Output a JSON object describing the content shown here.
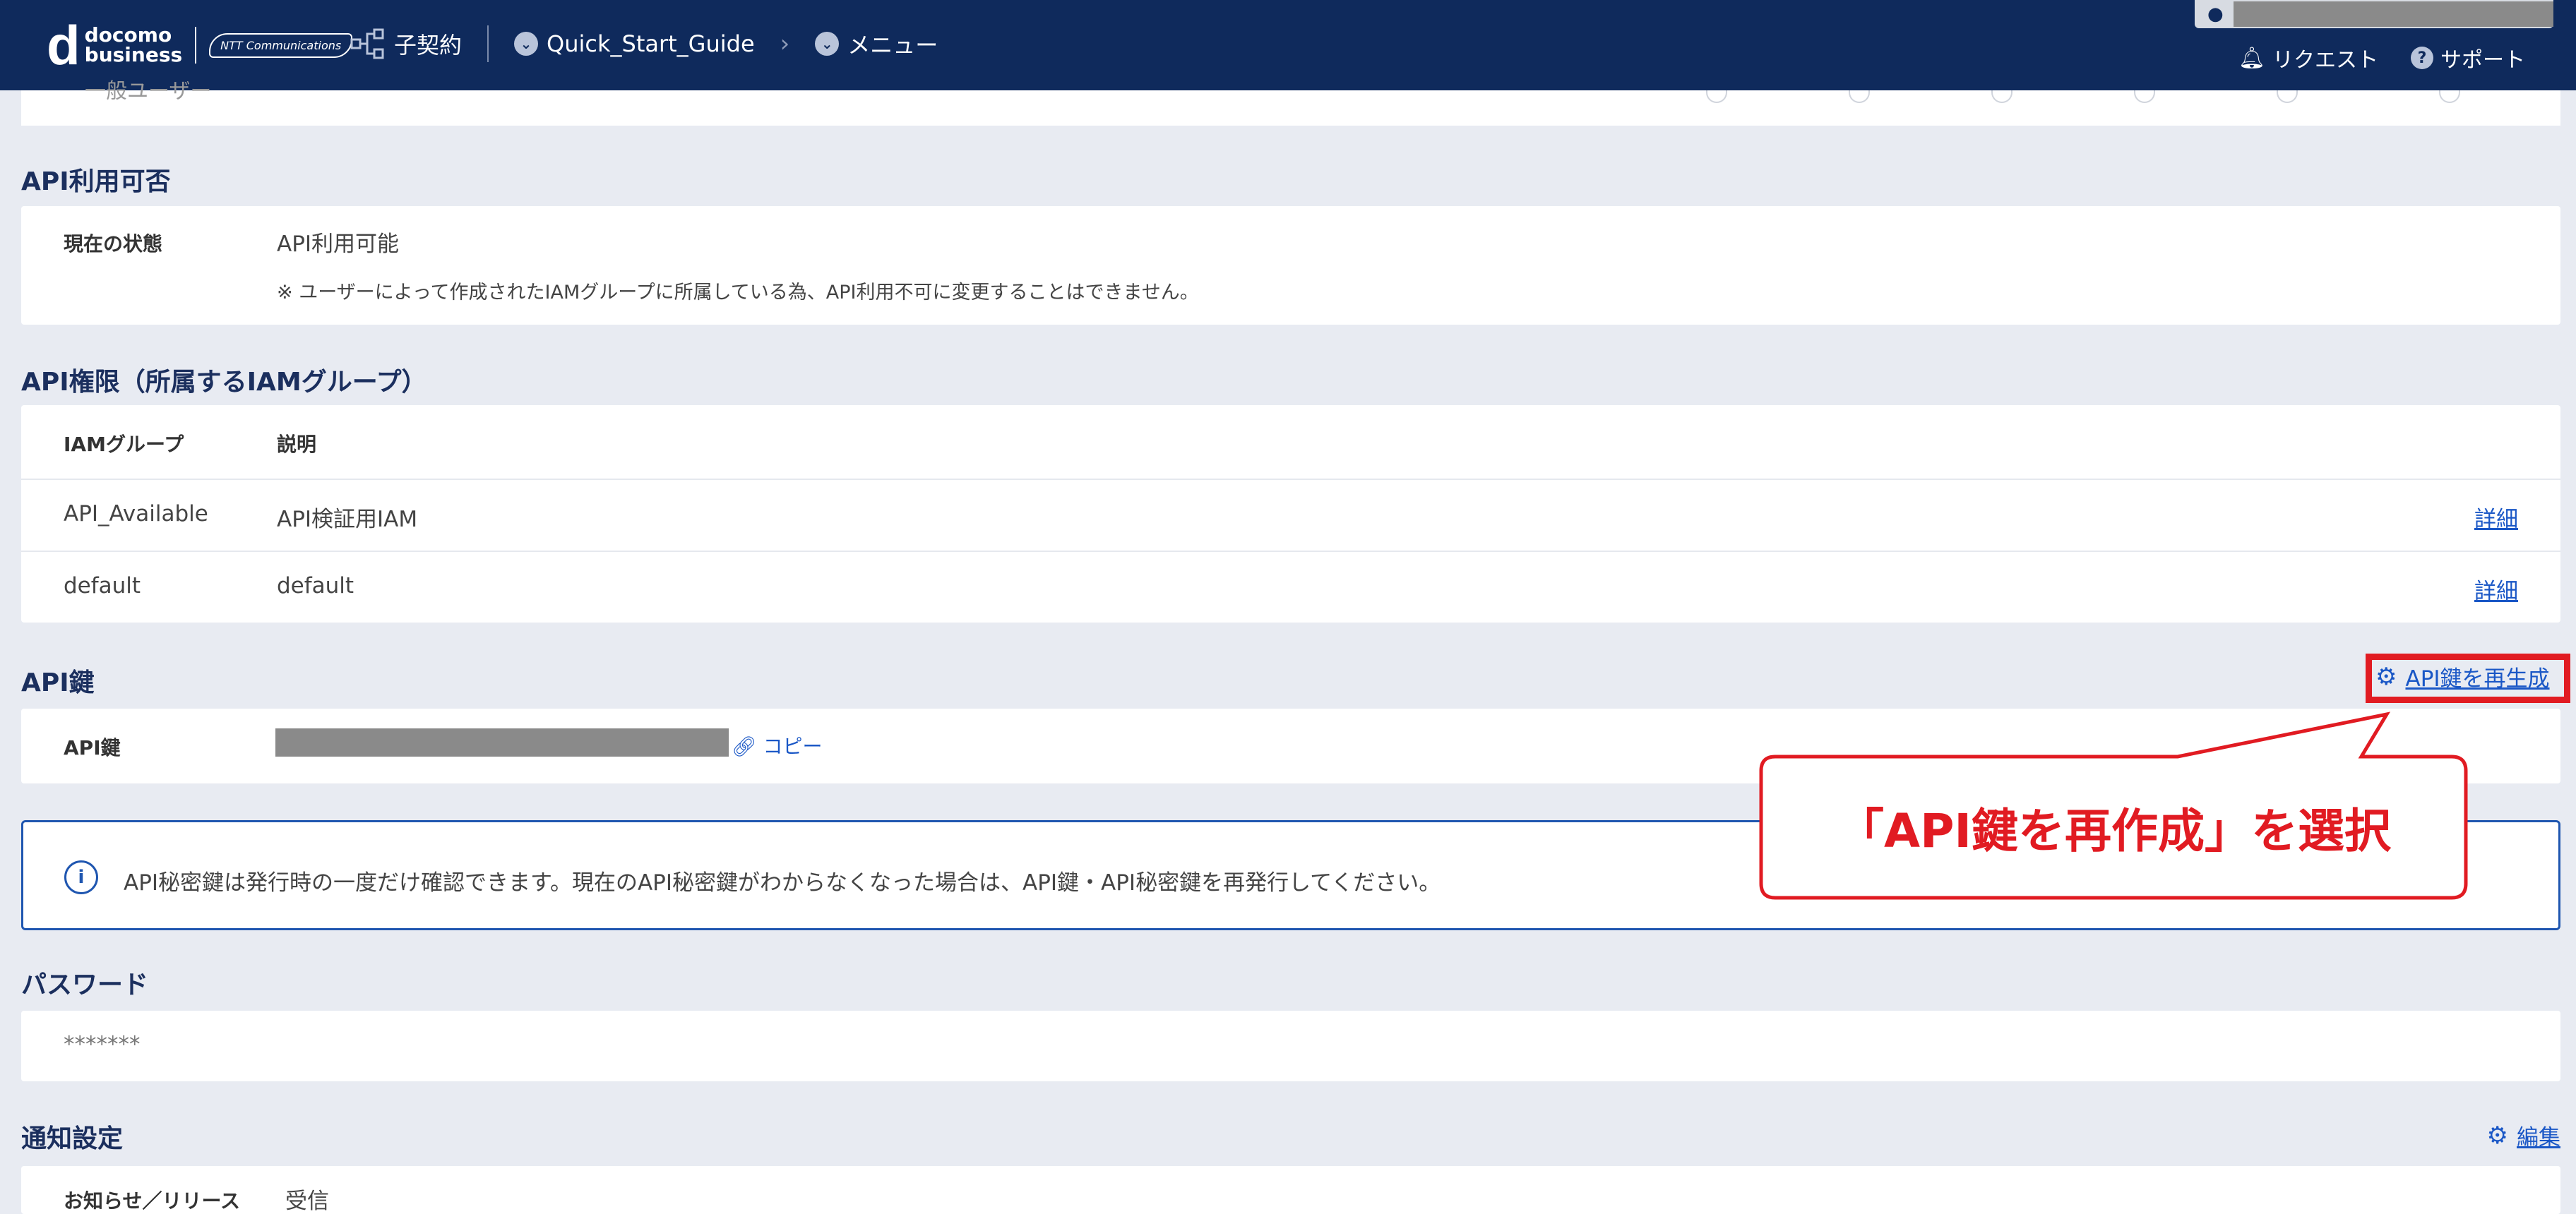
{
  "header": {
    "logo_line1": "docomo",
    "logo_line2": "business",
    "logo_partner": "NTT Communications",
    "nav_contract": "子契約",
    "breadcrumb_1": "Quick_Start_Guide",
    "breadcrumb_2": "メニュー",
    "action_request": "リクエスト",
    "action_support": "サポート"
  },
  "prev_section_row": "一般ユーザー",
  "api_usage": {
    "title": "API利用可否",
    "status_label": "現在の状態",
    "status_value": "API利用可能",
    "note": "※ ユーザーによって作成されたIAMグループに所属している為、API利用不可に変更することはできません。"
  },
  "api_permissions": {
    "title": "API権限（所属するIAMグループ）",
    "col_group": "IAMグループ",
    "col_desc": "説明",
    "rows": [
      {
        "group": "API_Available",
        "desc": "API検証用IAM",
        "link": "詳細"
      },
      {
        "group": "default",
        "desc": "default",
        "link": "詳細"
      }
    ]
  },
  "api_key": {
    "title": "API鍵",
    "regenerate_label": "API鍵を再生成",
    "key_label": "API鍵",
    "copy_label": "コピー"
  },
  "info_message": "API秘密鍵は発行時の一度だけ確認できます。現在のAPI秘密鍵がわからなくなった場合は、API鍵・API秘密鍵を再発行してください。",
  "password": {
    "title": "パスワード",
    "value": "*******"
  },
  "notifications": {
    "title": "通知設定",
    "edit_label": "編集",
    "row_label": "お知らせ／リリース",
    "row_value": "受信"
  },
  "annotation": {
    "callout_text": "「API鍵を再作成」を選択",
    "highlight_color": "#e11b22"
  },
  "colors": {
    "header_bg": "#0f2a5c",
    "page_bg": "#e8ebf2",
    "title_color": "#1b2f5e",
    "link_color": "#1a57c6"
  }
}
